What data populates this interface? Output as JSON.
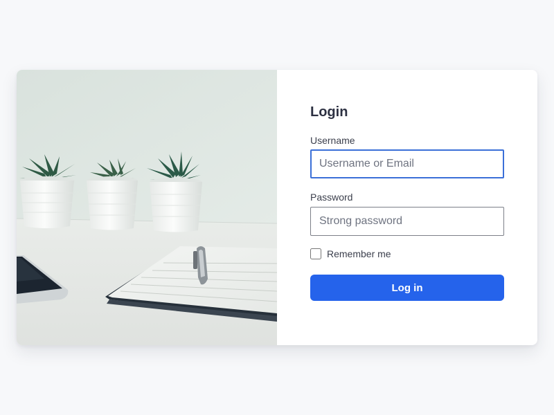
{
  "login": {
    "title": "Login",
    "username_label": "Username",
    "username_placeholder": "Username or Email",
    "password_label": "Password",
    "password_placeholder": "Strong password",
    "remember_label": "Remember me",
    "remember_checked": false,
    "submit_label": "Log in"
  },
  "colors": {
    "accent": "#2563eb",
    "focus_border": "#3a6fd8",
    "page_background": "#f7f8fa",
    "title_text": "#2d3142"
  },
  "photo": {
    "icons": [
      "succulent-pot-icon",
      "notebook-icon",
      "pen-icon",
      "smartphone-icon"
    ]
  }
}
